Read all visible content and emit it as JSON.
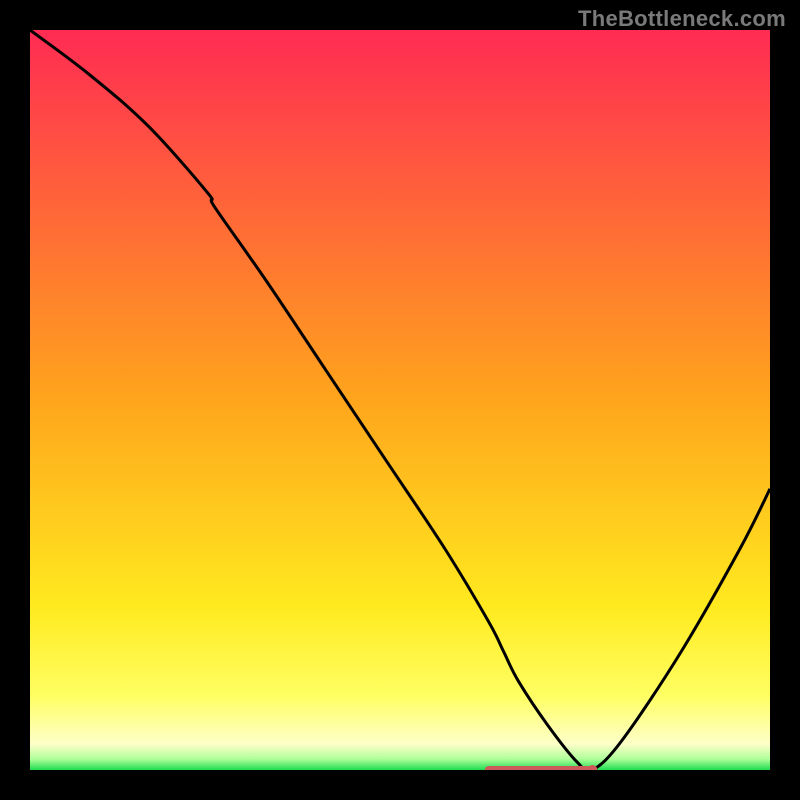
{
  "watermark": "TheBottleneck.com",
  "chart_data": {
    "type": "line",
    "title": "",
    "xlabel": "",
    "ylabel": "",
    "xlim": [
      0,
      100
    ],
    "ylim": [
      0,
      100
    ],
    "grid": false,
    "x": [
      0,
      8,
      16,
      24,
      25,
      32,
      40,
      48,
      56,
      62,
      64,
      66,
      70,
      74,
      76,
      80,
      88,
      96,
      100
    ],
    "values": [
      100,
      94,
      87,
      78,
      76,
      66,
      54,
      42,
      30,
      20,
      16,
      12,
      6,
      1,
      0,
      4,
      16,
      30,
      38
    ],
    "series": [
      {
        "name": "curve",
        "stroke": "#000000"
      }
    ],
    "marker": {
      "x_start": 62,
      "x_end": 76,
      "y": 0,
      "color": "#cc5a5a"
    },
    "gradient_stops": [
      {
        "offset": 0.0,
        "color": "#ff2b53"
      },
      {
        "offset": 0.5,
        "color": "#ffa51c"
      },
      {
        "offset": 0.78,
        "color": "#ffea1f"
      },
      {
        "offset": 0.9,
        "color": "#ffff63"
      },
      {
        "offset": 0.965,
        "color": "#fdffc8"
      },
      {
        "offset": 0.985,
        "color": "#b0ff9a"
      },
      {
        "offset": 1.0,
        "color": "#1fdc52"
      }
    ]
  }
}
